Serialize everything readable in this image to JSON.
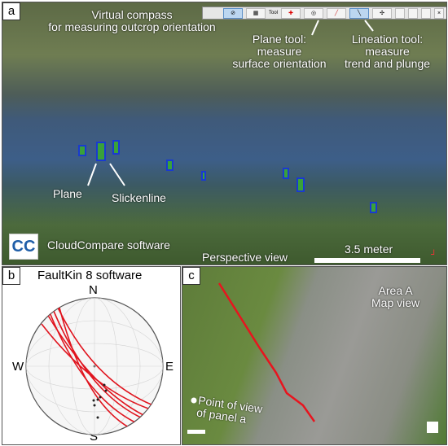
{
  "panel_a": {
    "label": "a",
    "compass_note": "Virtual compass\nfor measuring outcrop orientation",
    "plane_tool_note": "Plane tool:\nmeasure\nsurface orientation",
    "lineation_tool_note": "Lineation tool:\nmeasure\ntrend and plunge",
    "plane_label": "Plane",
    "slickenline_label": "Slickenline",
    "software_label": "CloudCompare software",
    "view_label": "Perspective view",
    "scale_label": "3.5 meter",
    "toolbar_tool_label": "Tool",
    "colors": {
      "plane_marker": "#3aa13a",
      "lineation_marker": "#1a3ad0"
    }
  },
  "panel_b": {
    "label": "b",
    "title": "FaultKin 8 software",
    "north": "N",
    "south": "S",
    "east": "E",
    "west": "W",
    "colors": {
      "great_circle": "#e0141e"
    }
  },
  "panel_c": {
    "label": "c",
    "area_label": "Area A\nMap view",
    "pov_label": "Point of view\nof panel a",
    "colors": {
      "fault_trace": "#e8141e"
    }
  }
}
